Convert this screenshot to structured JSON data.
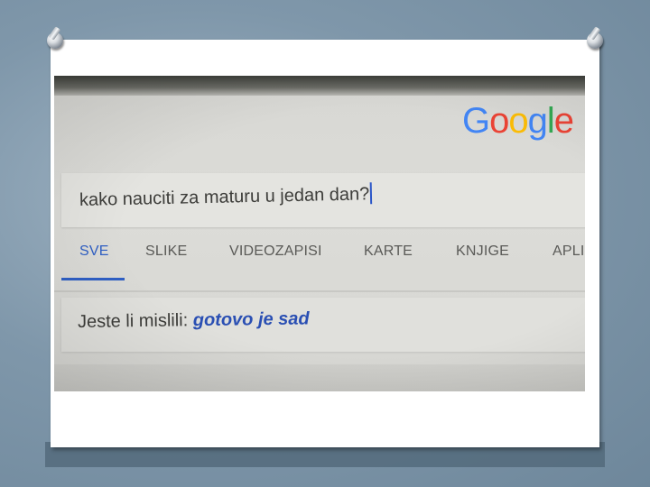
{
  "logo": {
    "letters": [
      "G",
      "o",
      "o",
      "g",
      "l",
      "e"
    ],
    "colors": [
      "#4285f4",
      "#ea4335",
      "#fbbc05",
      "#4285f4",
      "#34a853",
      "#ea4335"
    ]
  },
  "search": {
    "query": "kako nauciti za maturu u jedan dan?"
  },
  "tabs": [
    {
      "label": "SVE",
      "active": true
    },
    {
      "label": "SLIKE",
      "active": false
    },
    {
      "label": "VIDEOZAPISI",
      "active": false
    },
    {
      "label": "KARTE",
      "active": false
    },
    {
      "label": "KNJIGE",
      "active": false
    },
    {
      "label": "APLI",
      "active": false
    }
  ],
  "did_you_mean": {
    "prefix": "Jeste li mislili:",
    "suggestion": "gotovo je sad"
  },
  "colors": {
    "accent": "#2f5fc4",
    "background": "#7d95a9",
    "frame": "#ffffff"
  }
}
